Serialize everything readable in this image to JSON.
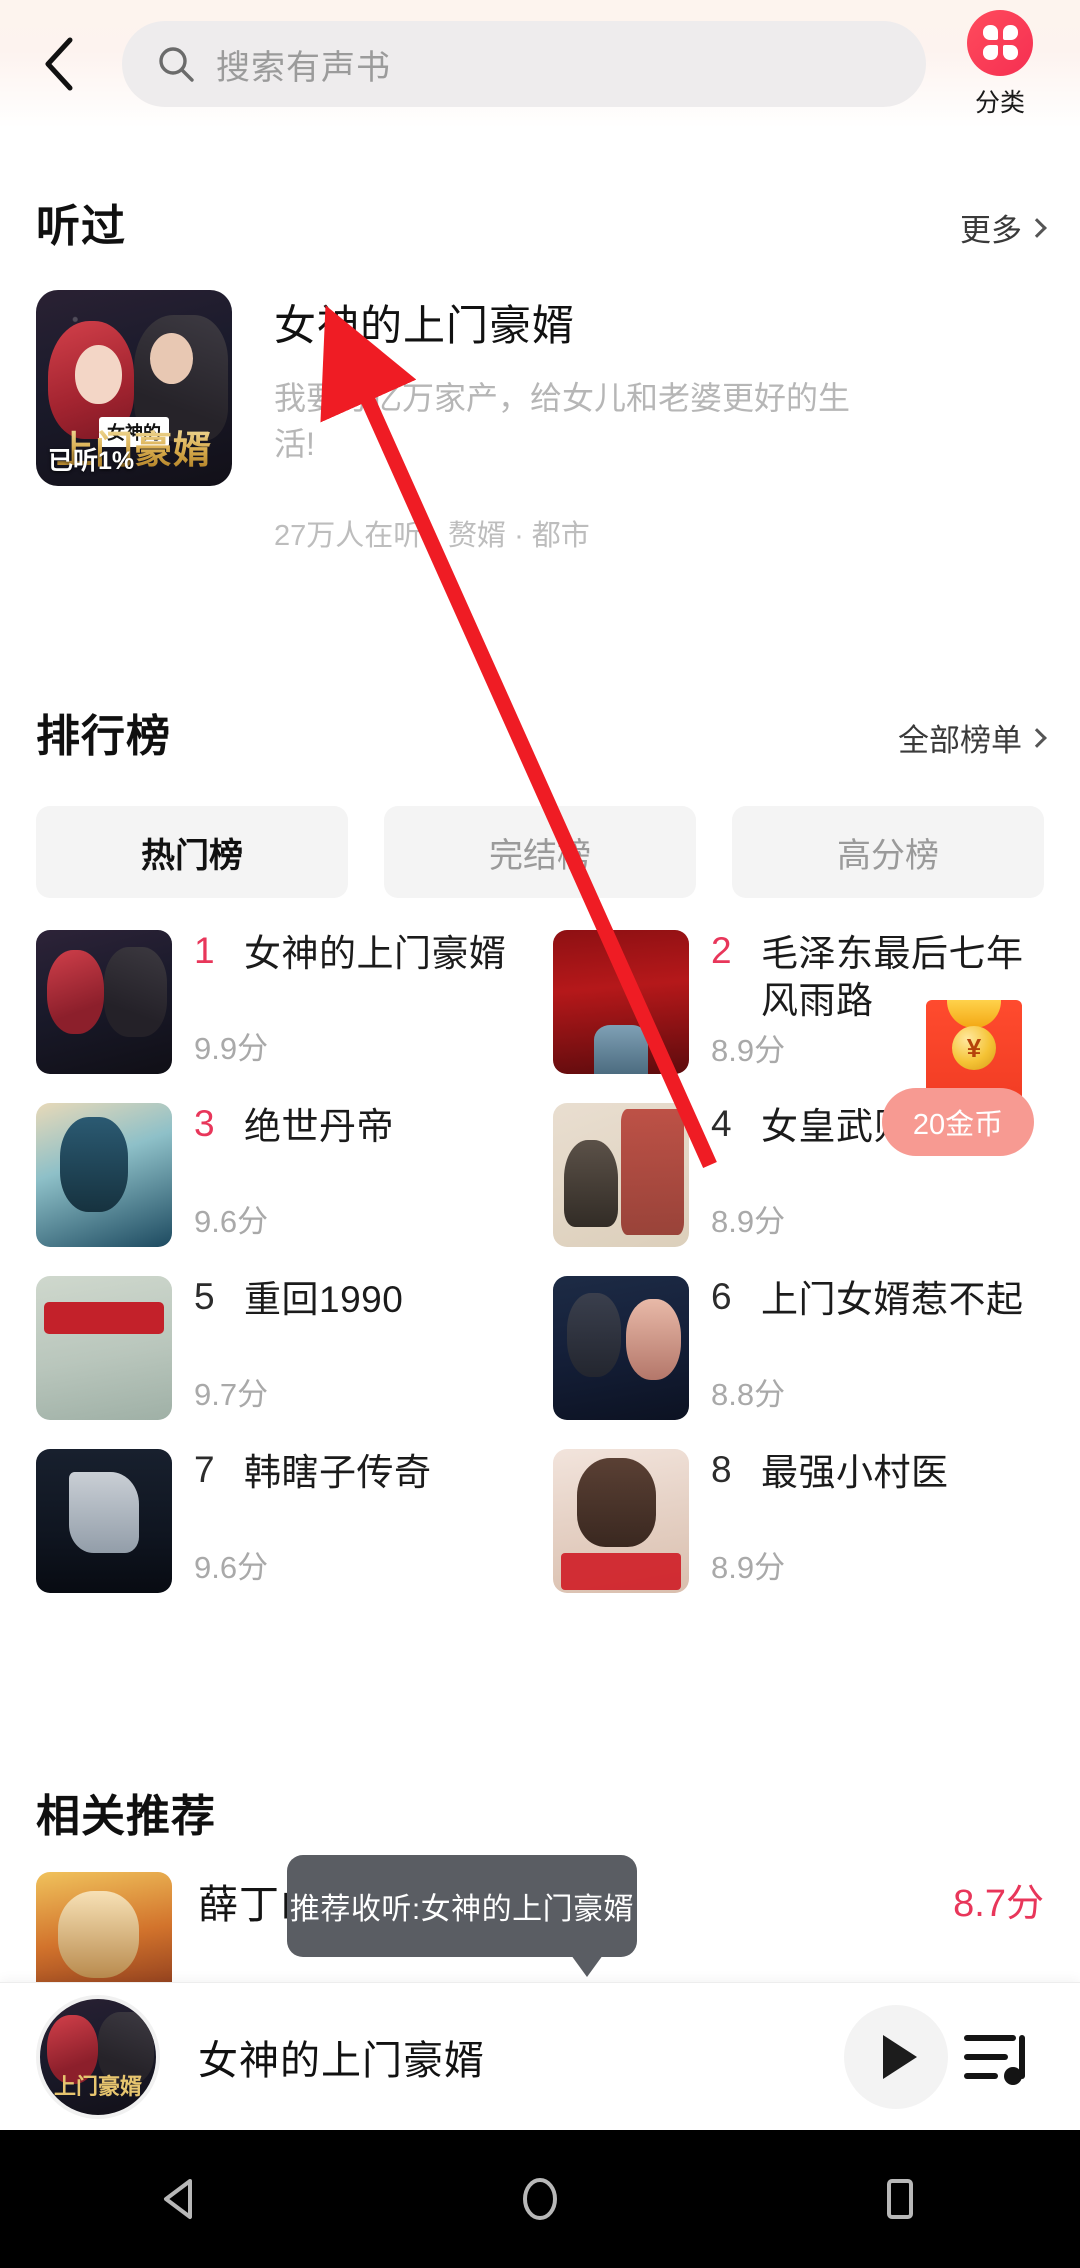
{
  "header": {
    "back_icon": "back-chevron-icon",
    "search_placeholder": "搜索有声书",
    "search_value": "",
    "search_icon": "search-icon",
    "category_label": "分类",
    "category_icon": "grid-category-icon",
    "accent_color": "#f52f52"
  },
  "listened": {
    "section_title": "听过",
    "more_label": "更多",
    "book": {
      "title": "女神的上门豪婿",
      "description": "我要分亿万家产，给女儿和老婆更好的生活!",
      "meta": "27万人在听 · 赘婿 · 都市",
      "progress_badge": "已听1%",
      "cover_band_top": "女神的",
      "cover_band_main": "上门豪婿"
    }
  },
  "rank": {
    "section_title": "排行榜",
    "more_label": "全部榜单",
    "tabs": [
      {
        "label": "热门榜",
        "active": true
      },
      {
        "label": "完结榜",
        "active": false
      },
      {
        "label": "高分榜",
        "active": false
      }
    ],
    "items": [
      {
        "num": "1",
        "name": "女神的上门豪婿",
        "score": "9.9分",
        "cover": "cv1"
      },
      {
        "num": "2",
        "name": "毛泽东最后七年风雨路",
        "score": "8.9分",
        "cover": "cv2"
      },
      {
        "num": "3",
        "name": "绝世丹帝",
        "score": "9.6分",
        "cover": "cv3"
      },
      {
        "num": "4",
        "name": "女皇武则天",
        "score": "8.9分",
        "cover": "cv4"
      },
      {
        "num": "5",
        "name": "重回1990",
        "score": "9.7分",
        "cover": "cv5"
      },
      {
        "num": "6",
        "name": "上门女婿惹不起",
        "score": "8.8分",
        "cover": "cv6"
      },
      {
        "num": "7",
        "name": "韩瞎子传奇",
        "score": "9.6分",
        "cover": "cv7"
      },
      {
        "num": "8",
        "name": "最强小村医",
        "score": "8.9分",
        "cover": "cv8"
      }
    ]
  },
  "recommend": {
    "section_title": "相关推荐",
    "items": [
      {
        "name": "薛丁山征西",
        "score": "8.7分",
        "cover": "cv9"
      }
    ]
  },
  "tooltip": {
    "text": "推荐收听:女神的上门豪婿"
  },
  "redpacket": {
    "label": "20金币",
    "coin_symbol": "¥"
  },
  "player": {
    "title": "女神的上门豪婿",
    "cover_text": "上门豪婿",
    "play_icon": "play-icon",
    "playlist_icon": "playlist-icon"
  },
  "navbar": {
    "back_icon": "android-back-icon",
    "home_icon": "android-home-icon",
    "recents_icon": "android-recents-icon"
  }
}
